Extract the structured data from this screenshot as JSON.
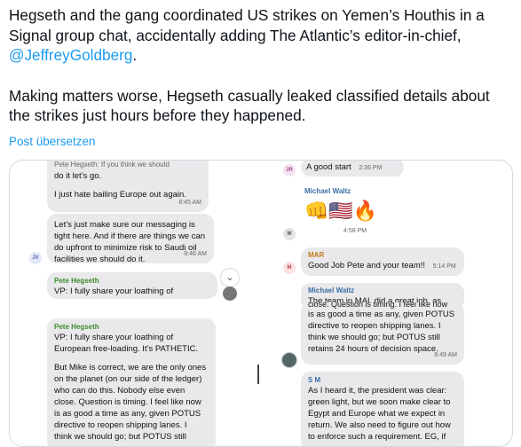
{
  "tweet": {
    "line1": "Hegseth and the gang coordinated US strikes on Yemen’s Houthis in a",
    "line2": "Signal group chat, accidentally adding The Atlantic’s editor-in-chief,",
    "mention": "@JeffreyGoldberg",
    "mention_suffix": ".",
    "line4": "Making matters worse, Hegseth casually leaked classified details about",
    "line5": "the strikes just hours before they happened.",
    "translate_label": "Post übersetzen"
  },
  "left_chat": {
    "b1_top": "Pete Hegseth: If you think we should",
    "b1_l2": "do it let’s go.",
    "b1_l3": "I just hate bailing Europe out again.",
    "b1_time": "8:45 AM",
    "b2_l1": "Let’s just make sure our messaging is",
    "b2_l2": "tight here. And if there are things we can",
    "b2_l3": "do upfront to minimize risk to Saudi oil",
    "b2_l4": "facilities we should do it.",
    "b2_time": "8:46 AM",
    "b2_avatar": "JV",
    "b3_sender": "Pete Hegseth",
    "b3_l1": "VP: I fully share your loathing of",
    "b4_sender": "Pete Hegseth",
    "b4_l1": "VP: I fully share your loathing of",
    "b4_l2": "European free-loading. It’s PATHETIC.",
    "b4_l3": "But Mike is correct, we are the only ones",
    "b4_l4": "on the planet (on our side of the ledger)",
    "b4_l5": "who can do this. Nobody else even",
    "b4_l6": "close. Question is timing. I feel like now",
    "b4_l7": "is as good a time as any, given POTUS",
    "b4_l8": "directive to reopen shipping lanes. I",
    "b4_l9": "think we should go; but POTUS still"
  },
  "right_chat": {
    "r1_avatar": "JR",
    "r1_text": "A good start",
    "r1_time": "2:36 PM",
    "r2_sender": "Michael Waltz",
    "r2_emojis": "👊🇺🇸🔥",
    "r2_avatar": "M",
    "r2_time": "4:58 PM",
    "r3_sender": "MAR",
    "r3_text": "Good Job Pete and your team!!",
    "r3_time": "5:14 PM",
    "r3_avatar": "M",
    "r4_sender": "Michael Waltz",
    "r4_text": "The team in MAL did a great job, as well.",
    "r5_l0": "close. Question is timing. I feel like now",
    "r5_l1": "is as good a time as any, given POTUS",
    "r5_l2": "directive to reopen shipping lanes. I",
    "r5_l3": "think we should go; but POTUS still",
    "r5_l4": "retains 24 hours of decision space.",
    "r5_time": "8:49 AM",
    "r6_sender": "S M",
    "r6_l1": "As I heard it, the president was clear:",
    "r6_l2": "green light, but we soon make clear to",
    "r6_l3": "Egypt and Europe what we expect in",
    "r6_l4": "return. We also need to figure out how",
    "r6_l5": "to enforce such a requirement. EG, if"
  },
  "colors": {
    "link": "#1d9bf0",
    "bubble": "#e9e9eb",
    "green_sender": "#3f8a2f",
    "blue_sender": "#3b6ea5"
  }
}
